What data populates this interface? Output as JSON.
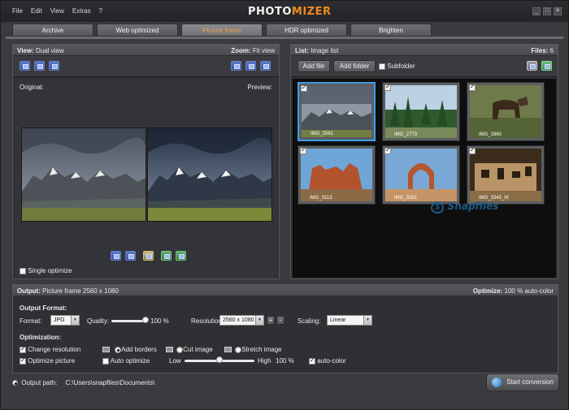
{
  "menu": [
    "File",
    "Edit",
    "View",
    "Extras",
    "?"
  ],
  "logo": {
    "part1": "PHOTO",
    "part2": "MIZER"
  },
  "window_controls": [
    "_",
    "□",
    "✕"
  ],
  "tabs": [
    {
      "label": "Archive",
      "active": false
    },
    {
      "label": "Web optimized",
      "active": false
    },
    {
      "label": "Picture frame",
      "active": true
    },
    {
      "label": "HDR optimized",
      "active": false
    },
    {
      "label": "Brighten",
      "active": false
    }
  ],
  "view_panel": {
    "view_label": "View:",
    "view_value": "Dual view",
    "zoom_label": "Zoom:",
    "zoom_value": "Fit view",
    "original_label": "Original:",
    "preview_label": "Preview:",
    "single_optimize": "Single optimize",
    "single_optimize_checked": false
  },
  "list_panel": {
    "list_label": "List:",
    "list_value": "Image list",
    "files_label": "Files:",
    "files_count": "6",
    "add_file": "Add file",
    "add_folder": "Add folder",
    "subfolder": "Subfolder",
    "subfolder_checked": false,
    "thumbnails": [
      {
        "name": "IMG_2561",
        "checked": true,
        "selected": true
      },
      {
        "name": "IMG_2773",
        "checked": true,
        "selected": false
      },
      {
        "name": "IMG_2860",
        "checked": true,
        "selected": false
      },
      {
        "name": "IMG_3113",
        "checked": true,
        "selected": false
      },
      {
        "name": "IMG_3261",
        "checked": true,
        "selected": false
      },
      {
        "name": "IMG_3345_hf",
        "checked": true,
        "selected": false
      }
    ],
    "watermark": "Snapfiles"
  },
  "output_bar": {
    "output_label": "Output:",
    "output_value": "Picture frame  2560 x 1080",
    "optimize_label": "Optimize:",
    "optimize_value": "100 % auto-color"
  },
  "output_format": {
    "title": "Output Format:",
    "format_label": "Format:",
    "format_value": "JPG",
    "quality_label": "Quality:",
    "quality_value": "100",
    "quality_unit": "%",
    "quality_fraction": 1.0,
    "resolution_label": "Resolution:",
    "resolution_value": "2560 x 1080",
    "plus": "+",
    "minus": "-",
    "scaling_label": "Scaling:",
    "scaling_value": "Linear"
  },
  "optimization": {
    "title": "Optimization:",
    "change_resolution": "Change resolution",
    "change_resolution_checked": true,
    "add_borders": "Add borders",
    "add_borders_on": true,
    "cut_image": "Cut image",
    "cut_image_on": false,
    "stretch_image": "Stretch image",
    "stretch_image_on": false,
    "optimize_picture": "Optimize picture",
    "optimize_picture_checked": true,
    "auto_optimize": "Auto optimize",
    "auto_optimize_checked": false,
    "low_label": "Low",
    "high_label": "High",
    "level_value": "100",
    "level_unit": "%",
    "level_fraction": 0.5,
    "auto_color": "auto-color",
    "auto_color_checked": true
  },
  "footer": {
    "output_path_label": "Output path:",
    "output_path_value": "C:\\Users\\snapfiles\\Documents\\",
    "start_conversion": "Start conversion"
  },
  "colors": {
    "accent_orange": "#f08a1f",
    "selection_blue": "#3e9de6",
    "background": "#3a3b3e"
  }
}
